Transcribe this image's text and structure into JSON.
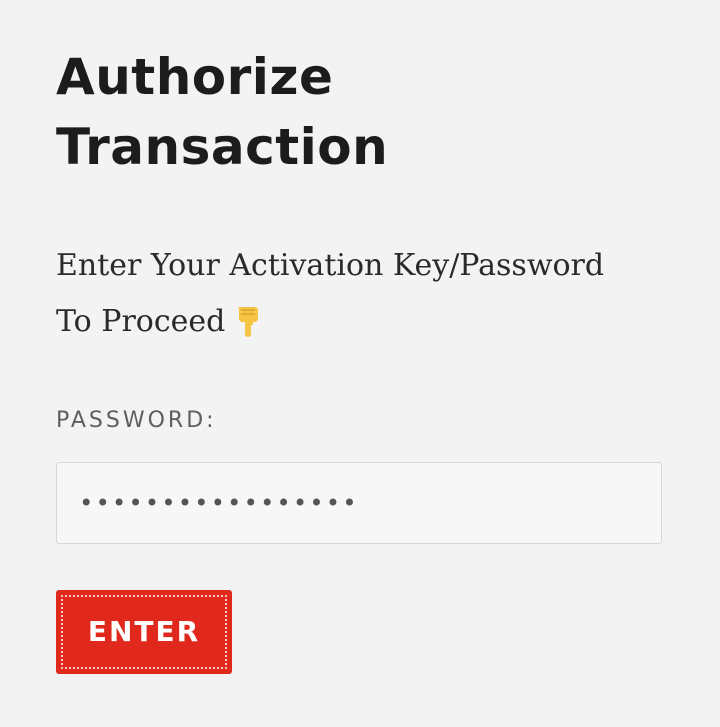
{
  "title": {
    "line1": "Authorize",
    "line2": "Transaction"
  },
  "instruction": {
    "line1": "Enter Your Activation Key/Password",
    "line2": "To Proceed",
    "icon": "pointing-down-hand-icon"
  },
  "password": {
    "label": "PASSWORD:",
    "value": "•••••••••••••••••"
  },
  "enter_button": {
    "label": "ENTER",
    "color": "#e0281c"
  }
}
